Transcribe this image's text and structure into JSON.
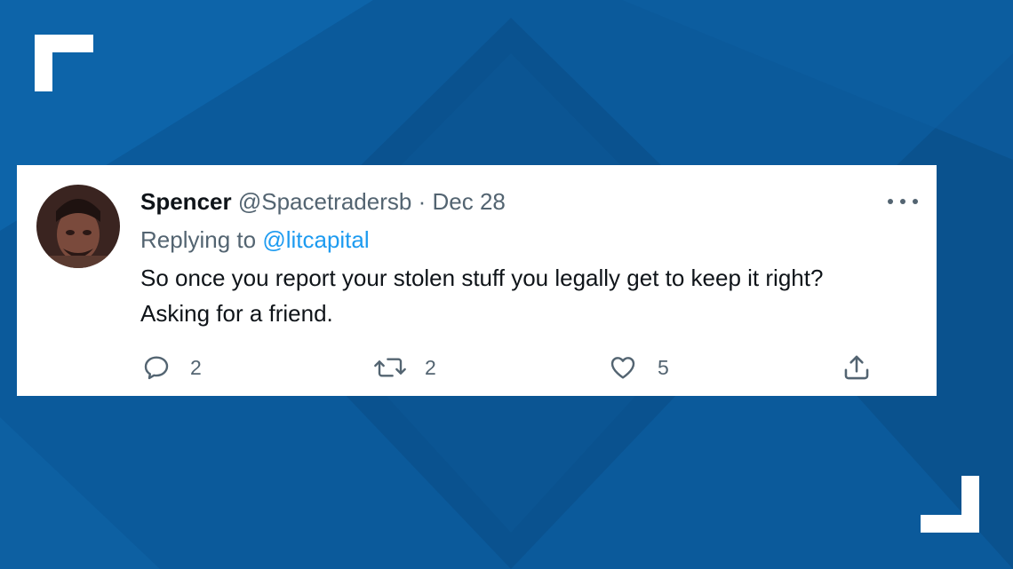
{
  "tweet": {
    "display_name": "Spencer",
    "handle": "@Spacetradersb",
    "separator": "·",
    "date": "Dec 28",
    "replying_prefix": "Replying to",
    "replying_handle": "@litcapital",
    "text_line1": "So once you report your stolen stuff you legally get to keep it right?",
    "text_line2": "Asking for a friend.",
    "actions": {
      "reply": {
        "icon": "reply-icon",
        "count": "2"
      },
      "retweet": {
        "icon": "retweet-icon",
        "count": "2"
      },
      "like": {
        "icon": "heart-icon",
        "count": "5"
      },
      "share": {
        "icon": "share-icon"
      }
    },
    "more_icon": "more-icon"
  },
  "colors": {
    "background": "#0a5a9c",
    "card": "#ffffff",
    "text": "#0f1419",
    "muted": "#536471",
    "mention": "#1d9bf0",
    "corner_bracket": "#ffffff"
  }
}
